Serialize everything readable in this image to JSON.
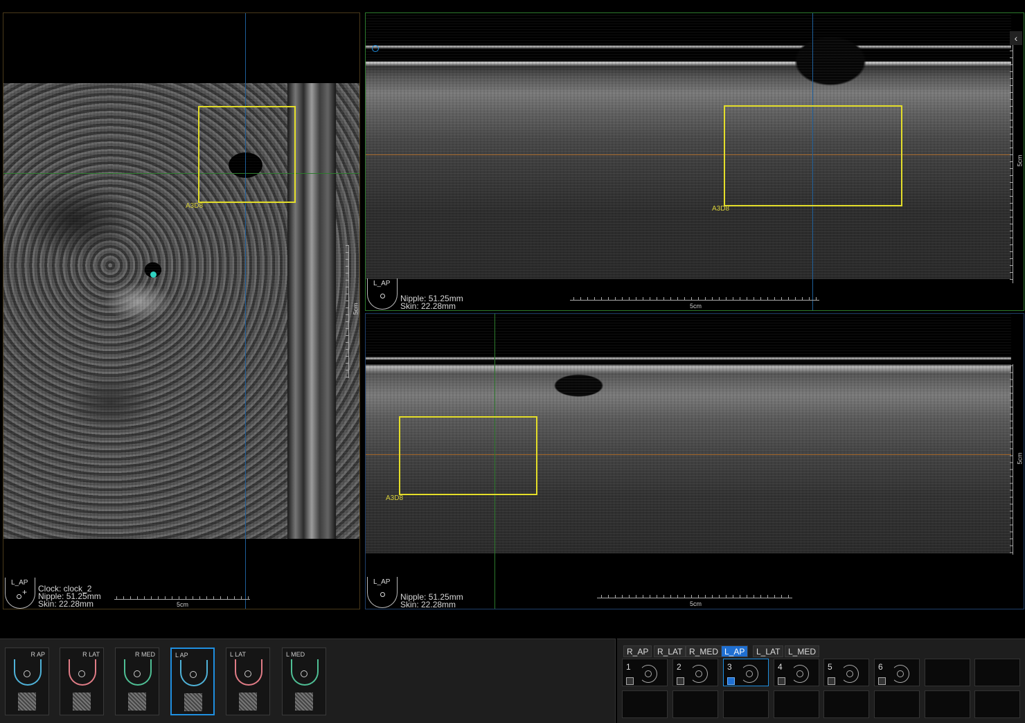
{
  "coronal_view": {
    "roi_label": "A3D8",
    "bodymark_label": "L_AP",
    "clock": "Clock: clock_2",
    "nipple": "Nipple: 51.25mm",
    "skin": "Skin: 22.28mm",
    "scale_h": "5cm",
    "scale_v": "5cm"
  },
  "top_view": {
    "roi_label": "A3D8",
    "bodymark_label": "L_AP",
    "nipple": "Nipple: 51.25mm",
    "skin": "Skin: 22.28mm",
    "scale_h": "5cm",
    "scale_v": "5cm"
  },
  "bottom_view": {
    "roi_label": "A3D8",
    "bodymark_label": "L_AP",
    "nipple": "Nipple: 51.25mm",
    "skin": "Skin: 22.28mm",
    "scale_h": "5cm",
    "scale_v": "5cm"
  },
  "collapse_icon": "‹",
  "thumbnails": [
    {
      "label": "R AP",
      "color": "#4fb2d8"
    },
    {
      "label": "R LAT",
      "color": "#e07c86"
    },
    {
      "label": "R MED",
      "color": "#4fbf95"
    },
    {
      "label": "L AP",
      "color": "#4fb2d8"
    },
    {
      "label": "L LAT",
      "color": "#e07c86"
    },
    {
      "label": "L MED",
      "color": "#4fbf95"
    }
  ],
  "view_tabs": [
    "R_AP",
    "R_LAT",
    "R_MED",
    "L_AP",
    "L_LAT",
    "L_MED"
  ],
  "active_tab": "L_AP",
  "slots": [
    "1",
    "2",
    "3",
    "4",
    "5",
    "6"
  ],
  "colors": {
    "roi": "#e4de29",
    "crosshair_blue": "#1f5f9a",
    "crosshair_green": "#2c7a2c",
    "crosshair_orange": "#a6682b",
    "accent": "#1f6fd1",
    "marker_cyan": "#2fd1c0"
  }
}
